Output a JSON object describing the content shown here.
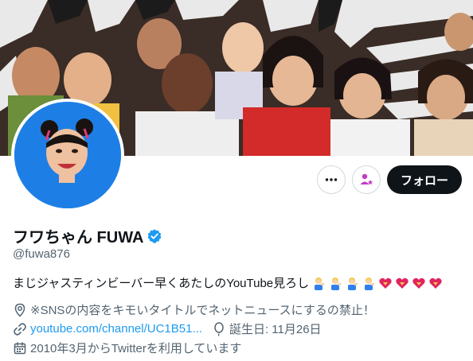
{
  "profile": {
    "display_name": "フワちゃん FUWA",
    "verified_icon": "verified-badge-icon",
    "handle": "@fuwa876",
    "bio": "まじジャスティンビーバー早くあたしのYouTube見ろし",
    "bio_emojis": [
      "person-tipping-hand",
      "person-tipping-hand",
      "person-tipping-hand",
      "person-tipping-hand",
      "heart-with-ribbon",
      "heart-with-ribbon",
      "heart-with-ribbon",
      "heart-with-ribbon"
    ],
    "location": "※SNSの内容をキモいタイトルでネットニュースにするの禁止！",
    "website": "youtube.com/channel/UC1B51...",
    "birthday": "誕生日: 11月26日",
    "joined": "2010年3月からTwitterを利用しています"
  },
  "actions": {
    "follow_label": "フォロー",
    "more_icon": "more-icon",
    "subscribe_icon": "subscribe-icon"
  },
  "colors": {
    "accent": "#1d9bf0",
    "follow_bg": "#0f1419",
    "avatar_bg": "#1d7fe6",
    "muted_text": "#536471"
  }
}
